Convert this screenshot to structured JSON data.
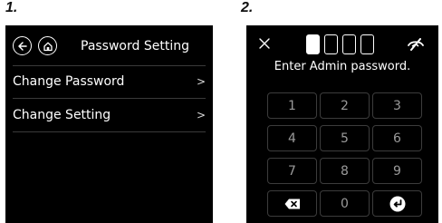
{
  "steps": {
    "step1_label": "1.",
    "step2_label": "2."
  },
  "screen1": {
    "back_icon": "arrow-left-icon",
    "home_icon": "home-icon",
    "title": "Password Setting",
    "menu": [
      {
        "label": "Change Password",
        "chevron": ">"
      },
      {
        "label": "Change Setting",
        "chevron": ">"
      }
    ]
  },
  "screen2": {
    "close_icon": "close-icon",
    "pin_slots": 4,
    "pin_filled": 1,
    "visibility_icon": "eye-slash-icon",
    "prompt": "Enter Admin password.",
    "keys": [
      "1",
      "2",
      "3",
      "4",
      "5",
      "6",
      "7",
      "8",
      "9",
      "0"
    ],
    "backspace_icon": "backspace-icon",
    "enter_icon": "enter-icon"
  },
  "colors": {
    "screen_bg": "#000000",
    "text": "#ffffff",
    "key_text": "#9a9a9a",
    "key_border": "#3c3c3c",
    "divider": "#3a3a3a"
  }
}
